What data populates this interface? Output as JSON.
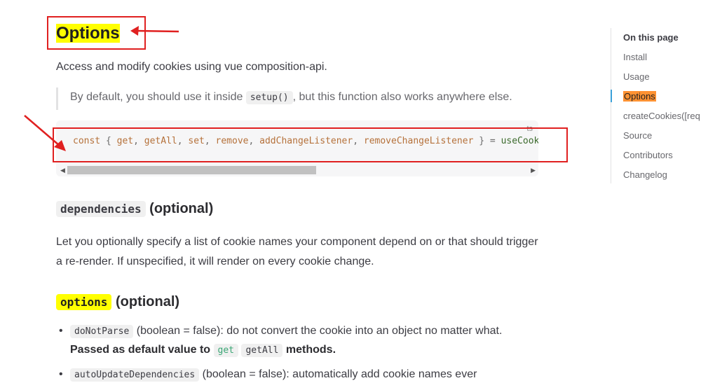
{
  "heading": {
    "title": "Options"
  },
  "intro": "Access and modify cookies using vue composition-api.",
  "tip": {
    "prefix": "By default, you should use it inside",
    "code": "setup()",
    "suffix": ", but this function also works anywhere else."
  },
  "code_block": {
    "lang": "ts",
    "keyword": "const",
    "open": "{",
    "items": [
      "get",
      "getAll",
      "set",
      "remove",
      "addChangeListener",
      "removeChangeListener"
    ],
    "close": "}",
    "eq": "=",
    "fn": "useCookie"
  },
  "dependencies": {
    "code": "dependencies",
    "tail": "(optional)",
    "text": "Let you optionally specify a list of cookie names your component depend on or that should trigger a re-render. If unspecified, it will render on every cookie change."
  },
  "options": {
    "code": "options",
    "tail": "(optional)",
    "items": [
      {
        "code": "doNotParse",
        "text": "(boolean = false): do not convert the cookie into an object no matter what.",
        "bold_prefix": "Passed as default value to",
        "code_get": "get",
        "code_getall": "getAll",
        "bold_suffix": "methods."
      },
      {
        "code": "autoUpdateDependencies",
        "text": "(boolean = false): automatically add cookie names ever"
      }
    ]
  },
  "toc": {
    "title": "On this page",
    "items": [
      "Install",
      "Usage",
      "Options",
      "createCookies([req",
      "Source",
      "Contributors",
      "Changelog"
    ],
    "active": "Options"
  },
  "colors": {
    "highlight": "#ffff00",
    "annotation": "#e02020",
    "toc_active": "#ff9233"
  }
}
